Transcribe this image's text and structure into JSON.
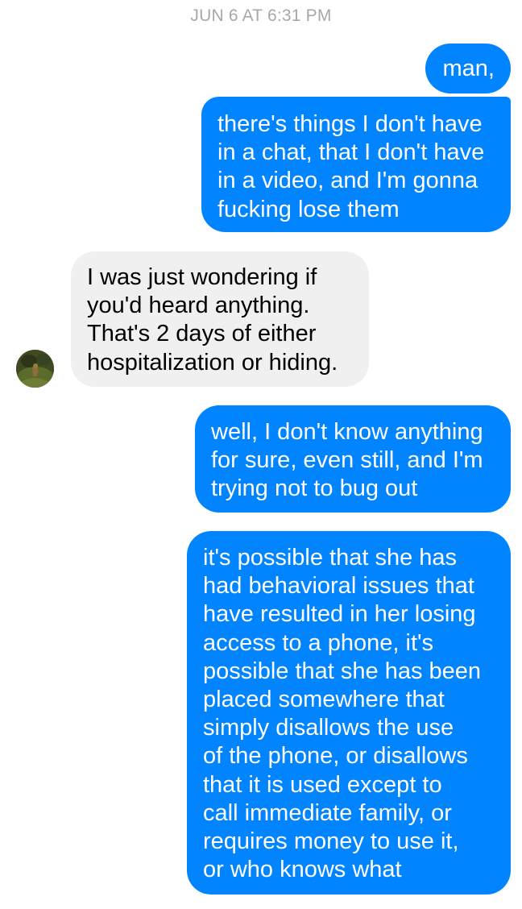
{
  "timestamp": "JUN 6 AT 6:31 PM",
  "messages": [
    {
      "sender": "me",
      "lines": [
        "man,"
      ]
    },
    {
      "sender": "me",
      "lines": [
        "there's things I don't have",
        "in a chat, that I don't have",
        "in a video, and I'm gonna",
        "fucking lose them"
      ]
    },
    {
      "sender": "contact",
      "lines": [
        "I was just wondering if",
        "you'd heard anything.",
        "That's 2 days of either",
        "hospitalization or hiding."
      ]
    },
    {
      "sender": "me",
      "lines": [
        "well, I don't know anything",
        "for sure, even still, and I'm",
        "trying not to bug out"
      ]
    },
    {
      "sender": "me",
      "lines": [
        "it's possible that she has",
        "had behavioral issues that",
        "have resulted in her losing",
        "access to a phone, it's",
        "possible that she has been",
        "placed somewhere that",
        "simply disallows the use",
        "of the phone, or disallows",
        "that it is used except to",
        "call immediate family, or",
        "requires money to use it,",
        "or who knows what"
      ]
    }
  ],
  "colors": {
    "outgoing_bubble": "#0084ff",
    "incoming_bubble": "#f0f0f0",
    "timestamp_text": "#a8a8a8"
  },
  "icons": {
    "contact_avatar": "avatar-photo"
  }
}
